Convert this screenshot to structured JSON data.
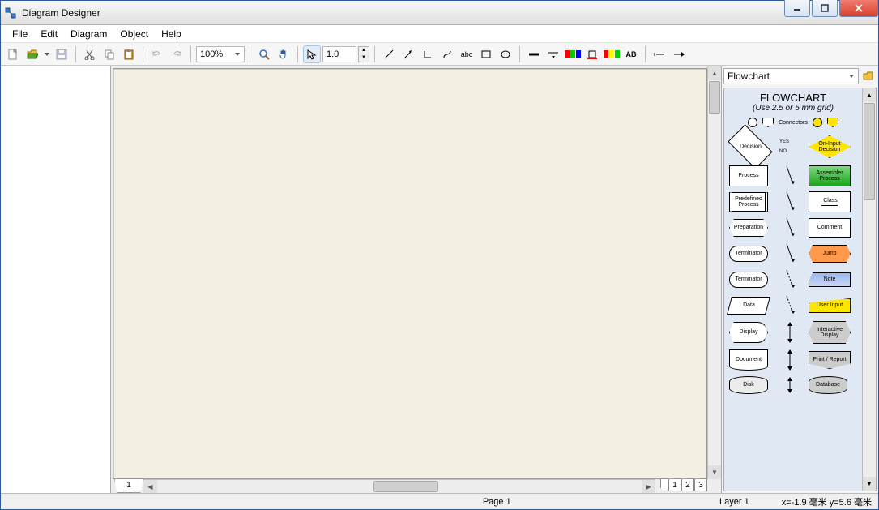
{
  "window": {
    "title": "Diagram Designer"
  },
  "menu": {
    "items": [
      "File",
      "Edit",
      "Diagram",
      "Object",
      "Help"
    ]
  },
  "toolbar": {
    "zoom_value": "100%",
    "line_width": "1.0"
  },
  "canvas": {
    "sheet_tab": "1",
    "layer_tabs": [
      "1",
      "2",
      "3"
    ]
  },
  "palette": {
    "selector": "Flowchart",
    "title": "FLOWCHART",
    "subtitle": "(Use 2.5 or 5 mm grid)",
    "connectors_label": "Connectors",
    "decision_label": "Decision",
    "decision_yes": "YES",
    "decision_no": "NO",
    "oninput_label": "On-Input Decision",
    "process": "Process",
    "assembler": "Assembler Process",
    "predef": "Predefined Process",
    "class": "Class",
    "prep": "Preparation",
    "comment": "Comment",
    "terminator": "Terminator",
    "jump": "Jump",
    "terminator2": "Terminator",
    "note": "Note",
    "data": "Data",
    "userinput": "User Input",
    "display": "Display",
    "idisplay": "Interactive Display",
    "document": "Document",
    "print": "Print / Report",
    "disk": "Disk",
    "database": "Database"
  },
  "status": {
    "page": "Page 1",
    "layer": "Layer 1",
    "coords": "x=-1.9 毫米  y=5.6 毫米"
  }
}
